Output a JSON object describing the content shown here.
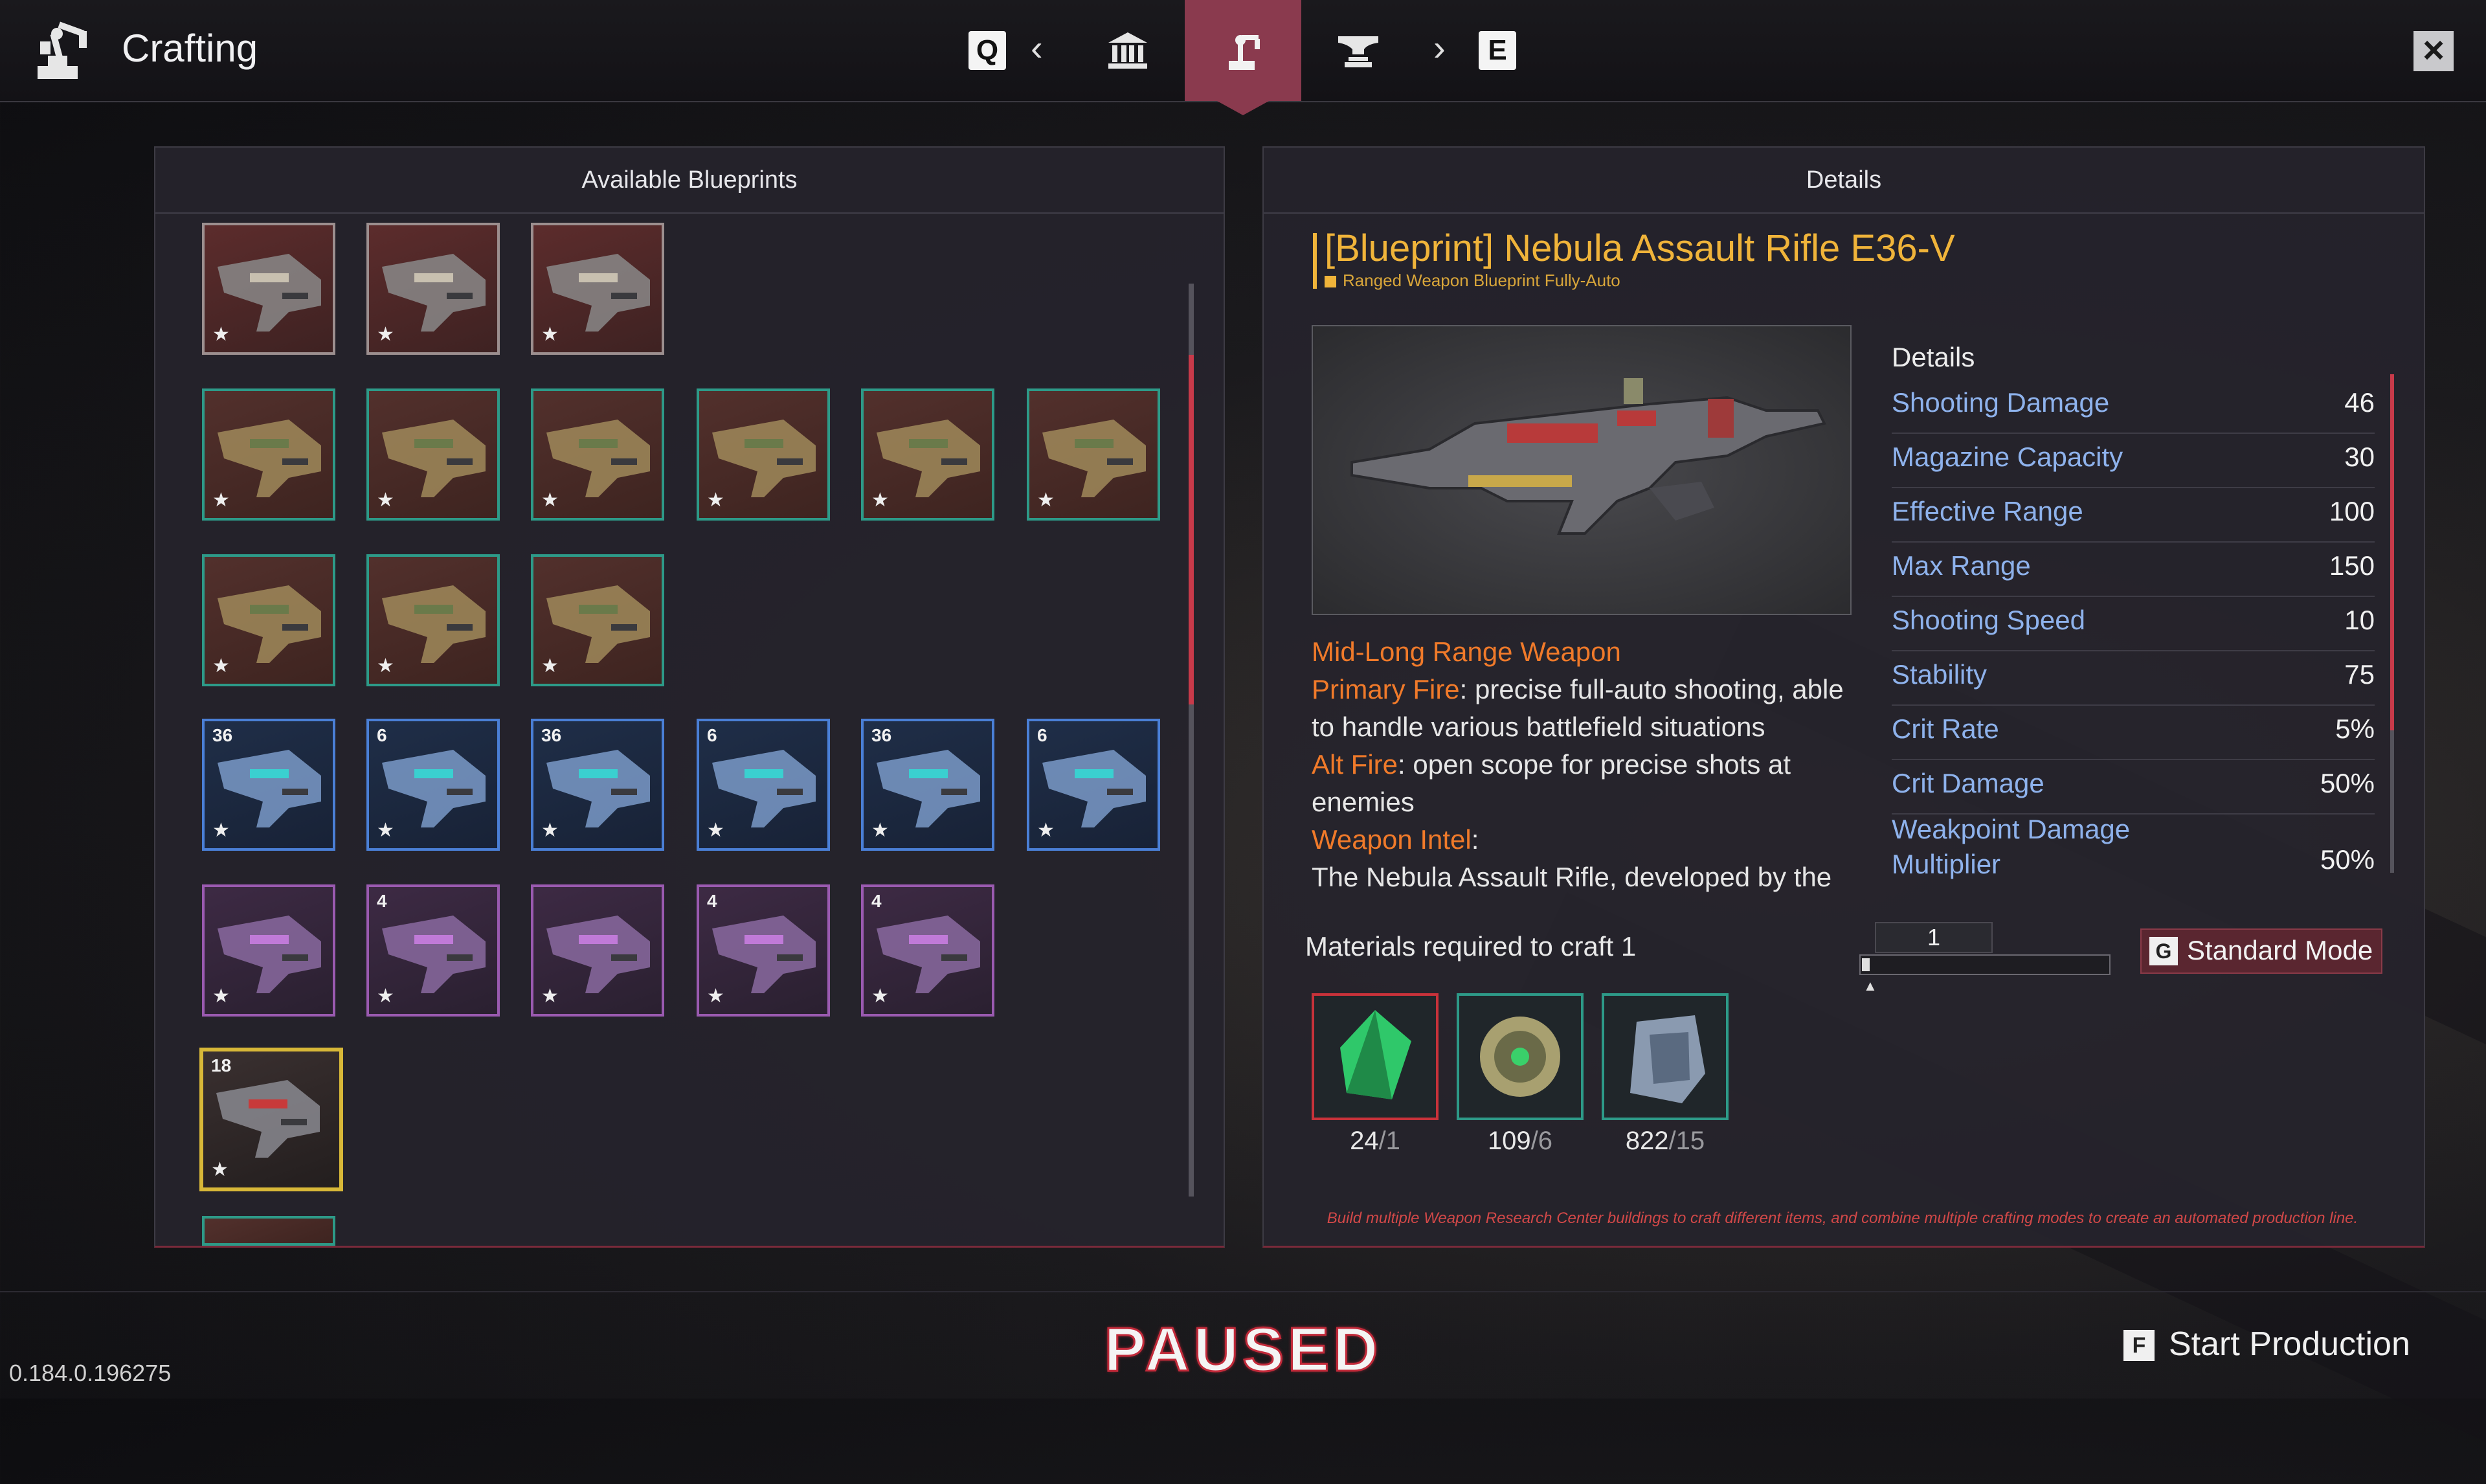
{
  "header": {
    "title": "Crafting",
    "prev_key": "Q",
    "next_key": "E",
    "tabs": [
      {
        "icon": "bank-icon"
      },
      {
        "icon": "robot-arm-icon",
        "active": true
      },
      {
        "icon": "anvil-icon"
      }
    ]
  },
  "blueprints": {
    "title": "Available Blueprints",
    "items": [
      {
        "rarity": "red"
      },
      {
        "rarity": "red"
      },
      {
        "rarity": "red"
      },
      {
        "rarity": "green"
      },
      {
        "rarity": "green"
      },
      {
        "rarity": "green"
      },
      {
        "rarity": "green"
      },
      {
        "rarity": "green"
      },
      {
        "rarity": "green"
      },
      {
        "rarity": "green"
      },
      {
        "rarity": "green"
      },
      {
        "rarity": "green"
      },
      {
        "rarity": "blue",
        "count": "36"
      },
      {
        "rarity": "blue",
        "count": "6"
      },
      {
        "rarity": "blue",
        "count": "36"
      },
      {
        "rarity": "blue",
        "count": "6"
      },
      {
        "rarity": "blue",
        "count": "36"
      },
      {
        "rarity": "blue",
        "count": "6"
      },
      {
        "rarity": "purple"
      },
      {
        "rarity": "purple",
        "count": "4"
      },
      {
        "rarity": "purple"
      },
      {
        "rarity": "purple",
        "count": "4"
      },
      {
        "rarity": "purple",
        "count": "4"
      },
      {
        "rarity": "gold",
        "count": "18",
        "selected": true
      }
    ]
  },
  "details": {
    "title": "Details",
    "blueprint_name": "[Blueprint] Nebula Assault Rifle E36-V",
    "blueprint_type": "Ranged Weapon Blueprint Fully-Auto",
    "role": "Mid-Long Range Weapon",
    "primary_label": "Primary Fire",
    "primary_text": ": precise full-auto shooting, able to handle various battlefield situations",
    "alt_label": "Alt Fire",
    "alt_text": ": open scope for precise shots at enemies",
    "intel_label": "Weapon Intel",
    "intel_colon": ":",
    "intel_text": "The Nebula Assault Rifle, developed by the",
    "stats_title": "Details",
    "stats": [
      {
        "label": "Shooting Damage",
        "value": "46"
      },
      {
        "label": "Magazine Capacity",
        "value": "30"
      },
      {
        "label": "Effective Range",
        "value": "100"
      },
      {
        "label": "Max Range",
        "value": "150"
      },
      {
        "label": "Shooting Speed",
        "value": "10"
      },
      {
        "label": "Stability",
        "value": "75"
      },
      {
        "label": "Crit Rate",
        "value": "5%"
      },
      {
        "label": "Crit Damage",
        "value": "50%"
      },
      {
        "label": "Weakpoint Damage Multiplier",
        "value": "50%"
      }
    ],
    "materials_label": "Materials required to craft 1",
    "quantity": "1",
    "mode_key": "G",
    "mode_label": "Standard Mode",
    "materials": [
      {
        "icon": "green-crystal-icon",
        "have": "24",
        "need": "/1",
        "color": "#c8323a"
      },
      {
        "icon": "sphere-core-icon",
        "have": "109",
        "need": "/6",
        "color": "#2d9a88"
      },
      {
        "icon": "ore-chunk-icon",
        "have": "822",
        "need": "/15",
        "color": "#2d9a88"
      }
    ],
    "hint": "Build multiple Weapon Research Center buildings to craft different items, and combine multiple crafting modes to create an automated production line."
  },
  "footer": {
    "paused": "PAUSED",
    "start_key": "F",
    "start_label": "Start Production",
    "version": "0.184.0.196275"
  },
  "colors": {
    "accent": "#8a3a4e",
    "title_gold": "#f0b43a",
    "stat_blue": "#8eb2ec",
    "orange": "#f07a2a"
  }
}
